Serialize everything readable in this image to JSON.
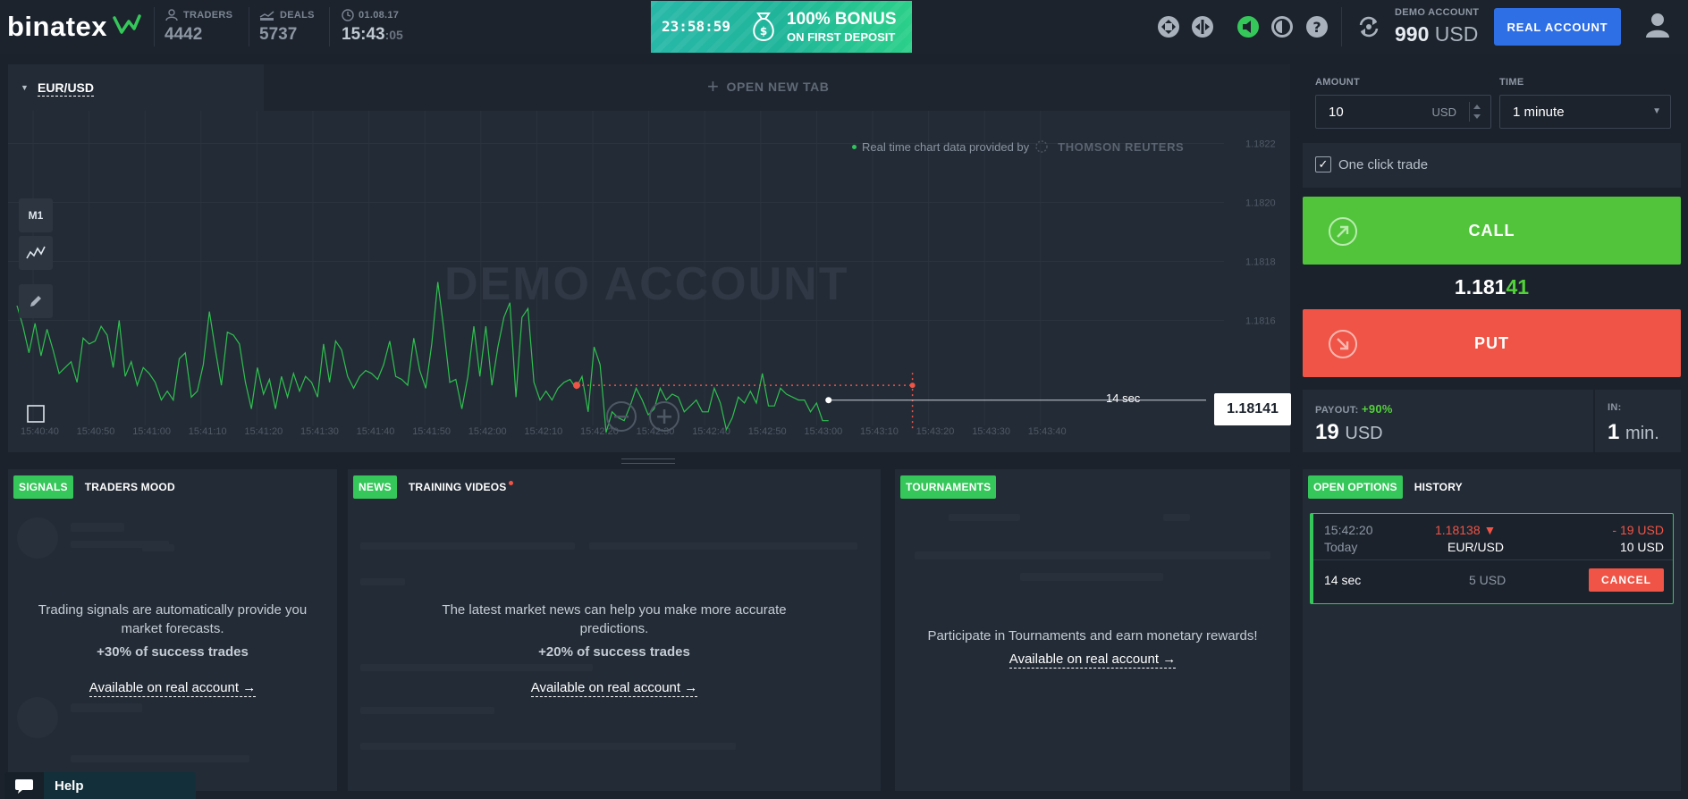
{
  "brand": {
    "name": "binatex"
  },
  "header": {
    "traders_label": "TRADERS",
    "traders_value": "4442",
    "deals_label": "DEALS",
    "deals_value": "5737",
    "date": "01.08.17",
    "time_hm": "15:43",
    "time_sec": ":05",
    "banner_timer": "23:58:59",
    "banner_title": "100% BONUS",
    "banner_sub": "ON FIRST DEPOSIT",
    "account_label": "DEMO ACCOUNT",
    "balance": "990",
    "balance_currency": "USD",
    "real_account_button": "REAL ACCOUNT"
  },
  "chart": {
    "active_tab": "EUR/USD",
    "new_tab": "OPEN NEW TAB",
    "provider_text": "Real time chart data provided by",
    "provider_name": "THOMSON REUTERS",
    "watermark": "DEMO ACCOUNT",
    "timeframe": "M1",
    "current_price": "1.18141",
    "countdown": "14 sec",
    "time_ticks": [
      "15:40:40",
      "15:40:50",
      "15:41:00",
      "15:41:10",
      "15:41:20",
      "15:41:30",
      "15:41:40",
      "15:41:50",
      "15:42:00",
      "15:42:10",
      "15:42:20",
      "15:42:30",
      "15:42:40",
      "15:42:50",
      "15:43:00",
      "15:43:10",
      "15:43:20",
      "15:43:30",
      "15:43:40"
    ],
    "price_ticks": [
      "1.1822",
      "1.1820",
      "1.1818",
      "1.1816"
    ]
  },
  "chart_data": {
    "type": "line",
    "title": "",
    "xlabel": "",
    "ylabel": "",
    "ylim": [
      1.18125,
      1.18225
    ],
    "series": [
      {
        "color": "#2fc04f",
        "values": [
          1.18165,
          1.18158,
          1.18149,
          1.18159,
          1.18148,
          1.18157,
          1.1815,
          1.18142,
          1.18144,
          1.18146,
          1.18139,
          1.18154,
          1.18152,
          1.18153,
          1.18158,
          1.18155,
          1.18144,
          1.1816,
          1.18141,
          1.18146,
          1.18138,
          1.18144,
          1.18142,
          1.18139,
          1.18133,
          1.18136,
          1.18133,
          1.18147,
          1.18149,
          1.18134,
          1.18136,
          1.18145,
          1.18163,
          1.1815,
          1.18138,
          1.18156,
          1.18155,
          1.18152,
          1.18139,
          1.1813,
          1.18144,
          1.18135,
          1.1814,
          1.1813,
          1.18141,
          1.18134,
          1.18142,
          1.18136,
          1.18141,
          1.18139,
          1.18134,
          1.18152,
          1.18139,
          1.18153,
          1.1815,
          1.18141,
          1.18137,
          1.18141,
          1.18143,
          1.18142,
          1.1814,
          1.18145,
          1.18153,
          1.18141,
          1.1814,
          1.18138,
          1.18154,
          1.18143,
          1.18137,
          1.18152,
          1.18173,
          1.18157,
          1.18139,
          1.1814,
          1.1813,
          1.18141,
          1.18158,
          1.18141,
          1.18158,
          1.18138,
          1.18151,
          1.18161,
          1.18166,
          1.18134,
          1.18161,
          1.18164,
          1.18139,
          1.18133,
          1.18136,
          1.18133,
          1.18137,
          1.18139,
          1.1814,
          1.18137,
          1.18141,
          1.18129,
          1.18151,
          1.18145,
          1.18122,
          1.18129,
          1.18127,
          1.18126,
          1.18131,
          1.18137,
          1.18133,
          1.18128,
          1.1813,
          1.18137,
          1.18133,
          1.18135,
          1.18134,
          1.18129,
          1.18131,
          1.18133,
          1.18129,
          1.18129,
          1.18137,
          1.18132,
          1.18123,
          1.18127,
          1.18134,
          1.18132,
          1.18136,
          1.18132,
          1.18142,
          1.18131,
          1.18131,
          1.18137,
          1.18135,
          1.18134,
          1.18133,
          1.18133,
          1.18129,
          1.18132,
          1.18126,
          1.18126
        ],
        "x_start": "15:40:40",
        "x_end": "15:43:05"
      }
    ],
    "strike": {
      "time": "15:42:20",
      "price": 1.18138
    },
    "expiry": "15:43:20",
    "current": {
      "time": "15:43:05",
      "price": 1.18136
    },
    "grid": true
  },
  "trade": {
    "amount_label": "AMOUNT",
    "amount_value": "10",
    "amount_currency": "USD",
    "time_label": "TIME",
    "time_value": "1 minute",
    "one_click": "One click trade",
    "call_label": "CALL",
    "put_label": "PUT",
    "price_main": "1.181",
    "price_hi": "41",
    "payout_label": "PAYOUT:",
    "payout_pct": "+90%",
    "payout_value": "19",
    "payout_currency": "USD",
    "in_label": "IN:",
    "in_value": "1",
    "in_unit": "min."
  },
  "signals": {
    "tab1": "SIGNALS",
    "tab2": "TRADERS MOOD",
    "desc": "Trading signals are automatically provide you market forecasts.",
    "bold": "+30% of success trades",
    "link": "Available on real account →"
  },
  "news": {
    "tab1": "NEWS",
    "tab2": "TRAINING VIDEOS",
    "desc": "The latest market news can help you make more accurate predictions.",
    "bold": "+20% of success trades",
    "link": "Available on real account →"
  },
  "tournaments": {
    "tab1": "TOURNAMENTS",
    "desc": "Participate in Tournaments and earn monetary rewards!",
    "link": "Available on real account →"
  },
  "options": {
    "tab1": "OPEN OPTIONS",
    "tab2": "HISTORY",
    "time": "15:42:20",
    "day": "Today",
    "price": "1.18138 ▼",
    "pair": "EUR/USD",
    "result": "- 19 USD",
    "amount": "10 USD",
    "remaining": "14 sec",
    "stake": "5 USD",
    "cancel": "CANCEL"
  },
  "help": {
    "label": "Help"
  },
  "colors": {
    "accent_green": "#35c75a",
    "call": "#52c43c",
    "put": "#ef5446",
    "real_account": "#2e6fe6"
  }
}
